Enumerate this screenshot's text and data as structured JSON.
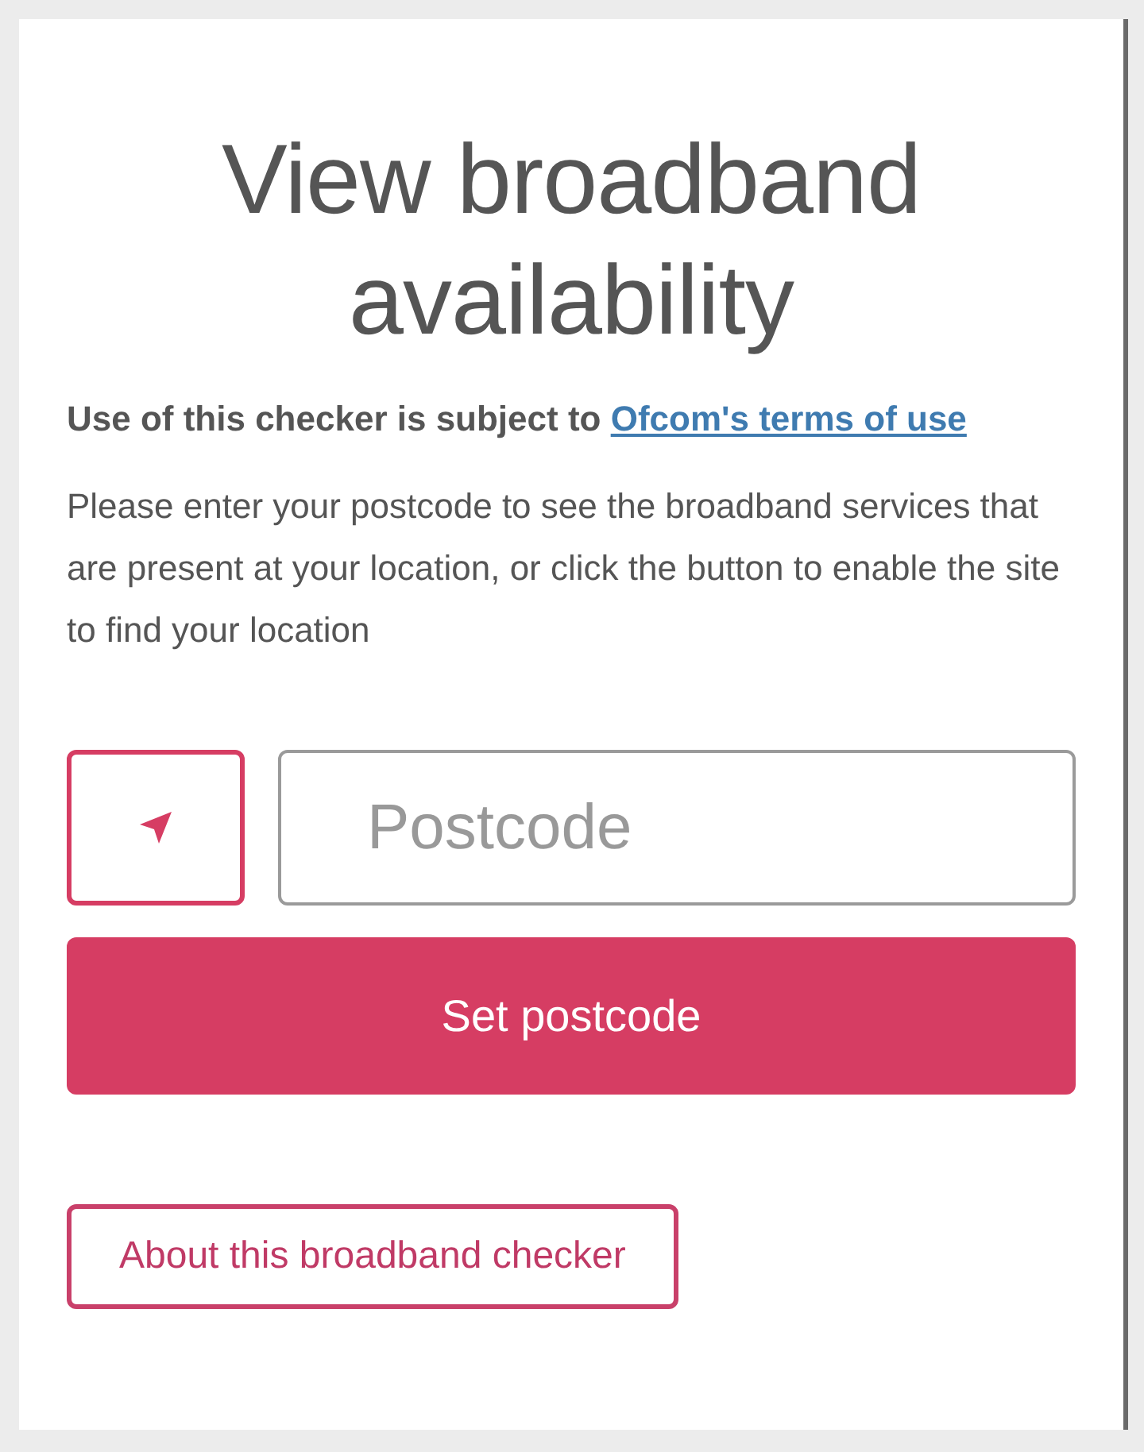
{
  "title": "View broadband availability",
  "terms": {
    "text": "Use of this checker is subject to ",
    "link": "Ofcom's terms of use"
  },
  "intro": "Please enter your postcode to see the broadband services that are present at your location, or click the button to enable the site to find your location",
  "postcode_field": {
    "placeholder": "Postcode"
  },
  "set_button": "Set postcode",
  "about_button": "About this broadband checker"
}
